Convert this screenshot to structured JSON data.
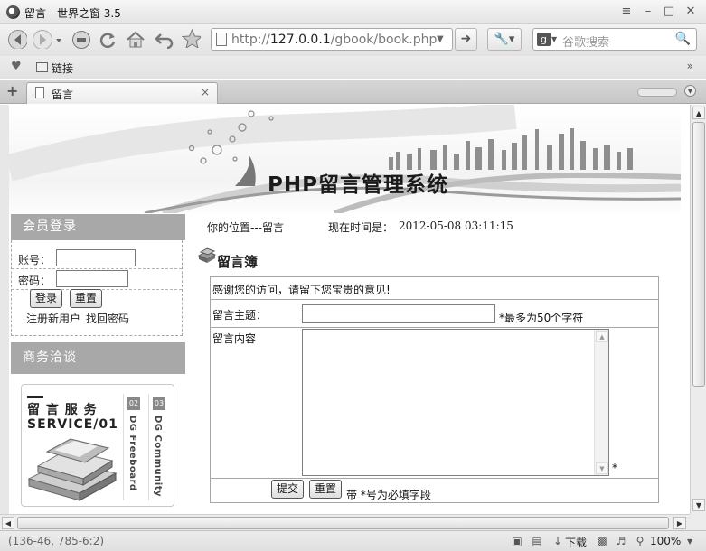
{
  "window": {
    "title": "留言 - 世界之窗 3.5"
  },
  "toolbar": {
    "url_prefix": "http://",
    "url_host": "127.0.0.1",
    "url_path": "/gbook/book.php",
    "search_placeholder": "谷歌搜索"
  },
  "bookmarks": {
    "folder_label": "链接",
    "more": "»"
  },
  "tabs": [
    {
      "label": "留言",
      "close": "×"
    }
  ],
  "banner": {
    "site_title": "PHP留言管理系统"
  },
  "sidebar": {
    "login_header": "会员登录",
    "account_label": "账号：",
    "password_label": "密码：",
    "login_button": "登录",
    "reset_button": "重置",
    "register_link": "注册新用户",
    "recover_link": "找回密码",
    "business_header": "商务洽谈",
    "promo": {
      "title_line1": "留 言 服 务",
      "title_line2": "SERVICE/01",
      "strip1_badge": "02",
      "strip1_text": "DG Freeboard",
      "strip2_badge": "03",
      "strip2_text": "DG Community"
    }
  },
  "main": {
    "breadcrumb": "你的位置---留言",
    "time_label": "现在时间是：",
    "time_value": "2012-05-08 03:11:15",
    "section_title": "留言簿",
    "welcome": "感谢您的访问，请留下您宝贵的意见!",
    "subject_label": "留言主题：",
    "subject_hint": "*最多为50个字符",
    "content_label": "留言内容",
    "content_star": "*",
    "submit_button": "提交",
    "reset_button": "重置",
    "required_note": "带  *号为必填字段"
  },
  "statusbar": {
    "coords": "(136-46, 785-6:2)",
    "download_label": "下载",
    "zoom": "100%"
  }
}
